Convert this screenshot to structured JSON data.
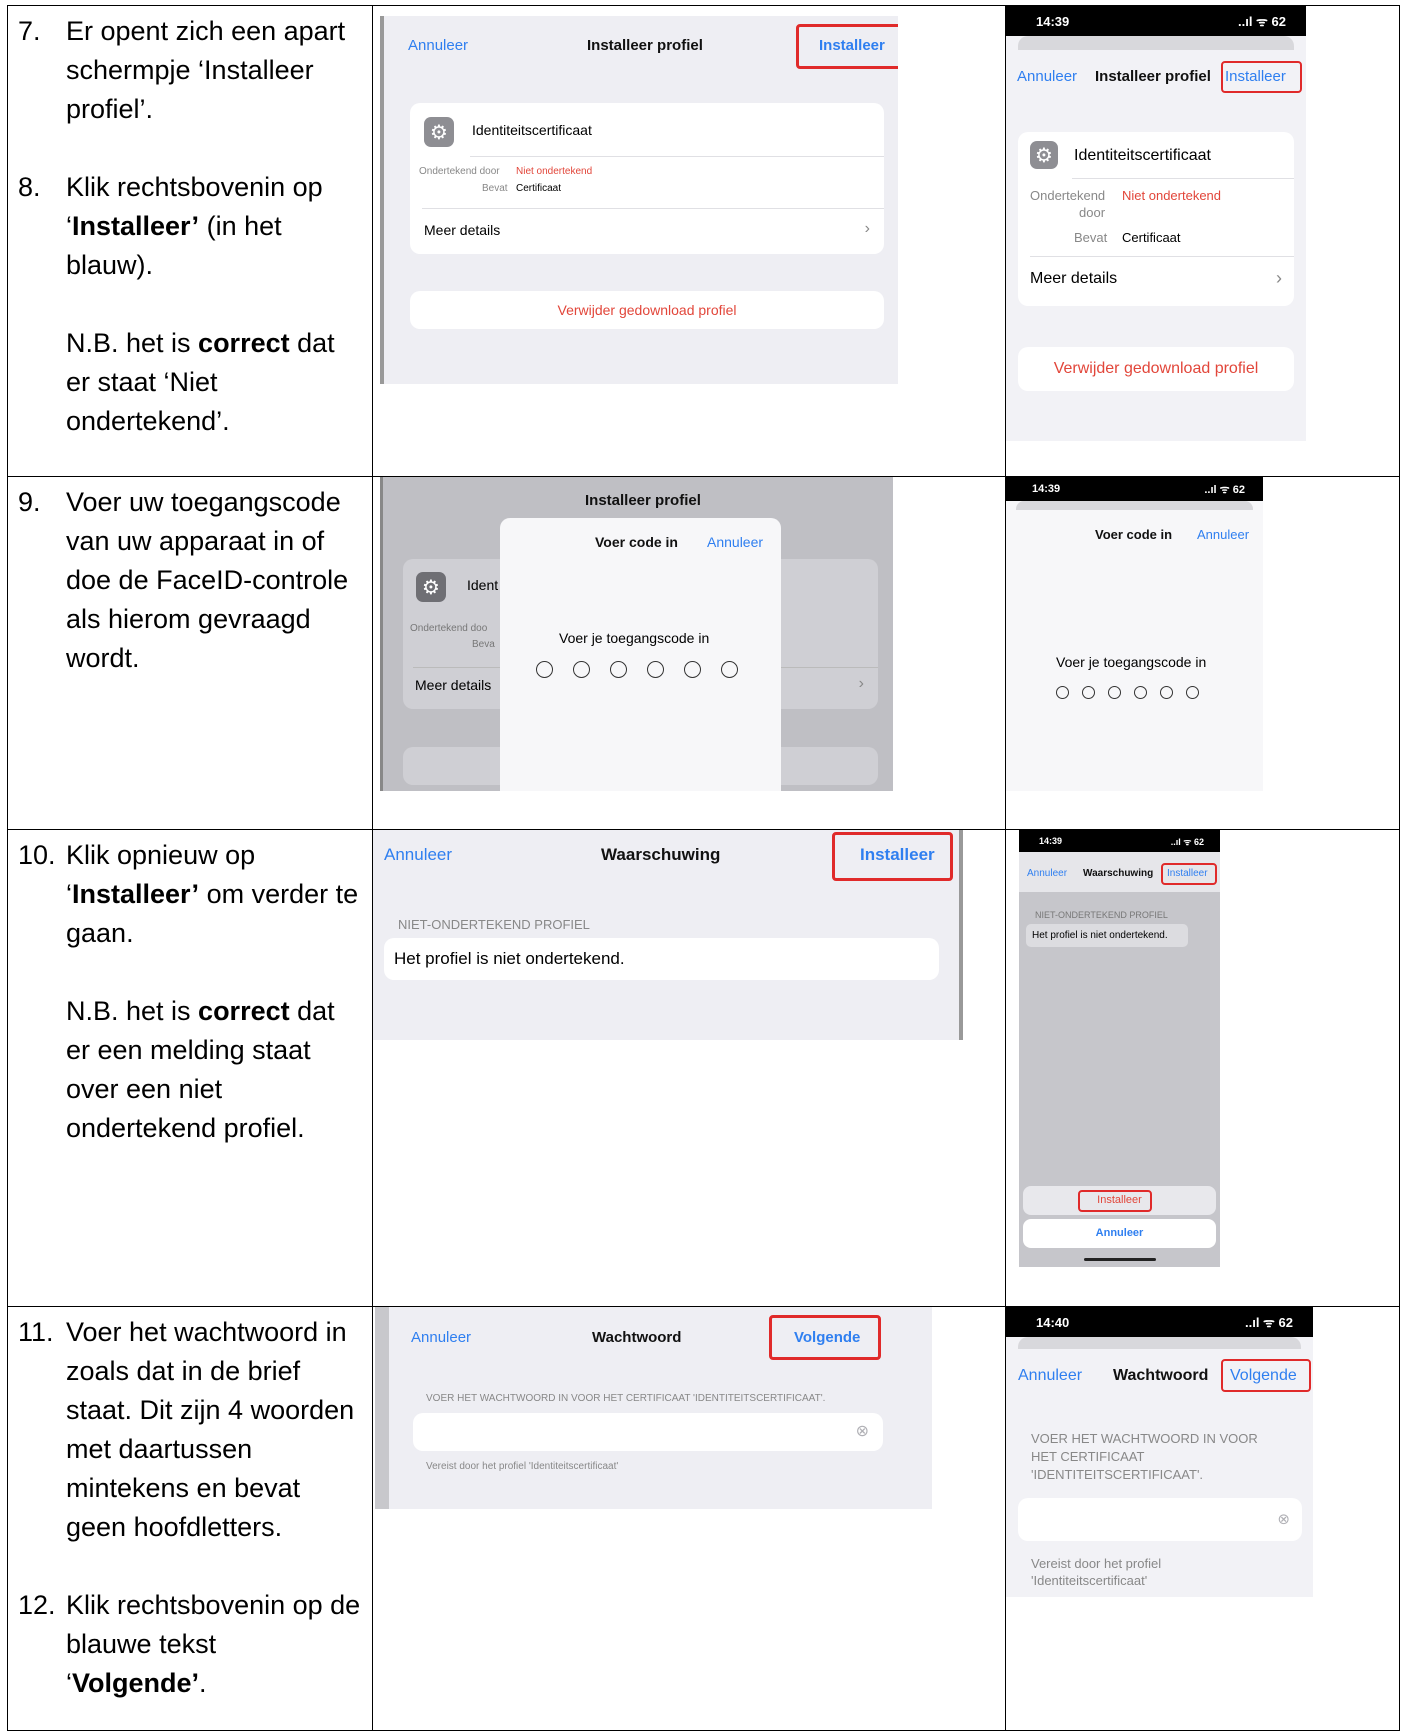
{
  "rows": [
    {
      "steps": [
        {
          "num": "7.",
          "text": "Er opent zich een apart schermpje ‘Installeer profiel’."
        },
        {
          "num": "8.",
          "text_pre": "Klik rechtsbovenin op ‘",
          "bold": "Installeer’",
          "text_post": " (in het blauw)."
        }
      ],
      "note": {
        "pre": "N.B. het is ",
        "bold": "correct",
        "post": " dat er staat ‘Niet ondertekend’."
      }
    },
    {
      "steps": [
        {
          "num": "9.",
          "text": "Voer uw toegangscode van uw apparaat in of doe de FaceID-controle als hierom gevraagd wordt."
        }
      ]
    },
    {
      "steps": [
        {
          "num": "10.",
          "text_pre": "Klik opnieuw op ‘",
          "bold": "Installeer’",
          "text_post": " om verder te gaan."
        }
      ],
      "note": {
        "pre": "N.B. het is ",
        "bold": "correct",
        "post": " dat er een melding staat over een niet ondertekend profiel."
      }
    },
    {
      "steps": [
        {
          "num": "11.",
          "text": "Voer het wachtwoord in zoals dat in de brief staat. Dit zijn 4 woorden met daartussen mintekens en bevat geen hoofdletters."
        },
        {
          "num": "12.",
          "text_pre": "Klik rechtsbovenin op de blauwe tekst ‘",
          "bold": "Volgende’",
          "text_post": "."
        }
      ]
    }
  ],
  "ui": {
    "cancel": "Annuleer",
    "install": "Installeer",
    "install_profile": "Installeer profiel",
    "identity_cert": "Identiteitscertificaat",
    "signed_by": "Ondertekend door",
    "signed_by_1": "Ondertekend",
    "signed_by_2": "door",
    "not_signed": "Niet ondertekend",
    "contains": "Bevat",
    "certificate": "Certificaat",
    "more_details": "Meer details",
    "remove_profile": "Verwijder gedownload profiel",
    "enter_code": "Voer code in",
    "enter_passcode": "Voer je toegangscode in",
    "ident_trunc": "Ident",
    "signed_trunc": "Ondertekend doo",
    "bevat_trunc": "Beva",
    "warning": "Waarschuwing",
    "unsigned_profile_header": "NIET-ONDERTEKEND PROFIEL",
    "profile_not_signed": "Het profiel is niet ondertekend.",
    "password": "Wachtwoord",
    "next": "Volgende",
    "enter_password_ipad": "VOER HET WACHTWOORD IN VOOR HET CERTIFICAAT 'IDENTITEITSCERTIFICAAT'.",
    "enter_password_phone_1": "VOER HET WACHTWOORD IN VOOR",
    "enter_password_phone_2": "HET CERTIFICAAT",
    "enter_password_phone_3": "'IDENTITEITSCERTIFICAAT'.",
    "required_ipad": "Vereist door het profiel 'Identiteitscertificaat'",
    "required_phone_1": "Vereist door het profiel",
    "required_phone_2": "'Identiteitscertificaat'",
    "time_1439": "14:39",
    "time_1440": "14:40",
    "status_icons": "..ıl ᯤ 62",
    "arrow": "›",
    "clear": "⊗"
  },
  "colors": {
    "ios_blue": "#2f7ff0",
    "ios_red": "#e2463a",
    "highlight": "#e02a2a",
    "ios_bg": "#eeeef3"
  }
}
